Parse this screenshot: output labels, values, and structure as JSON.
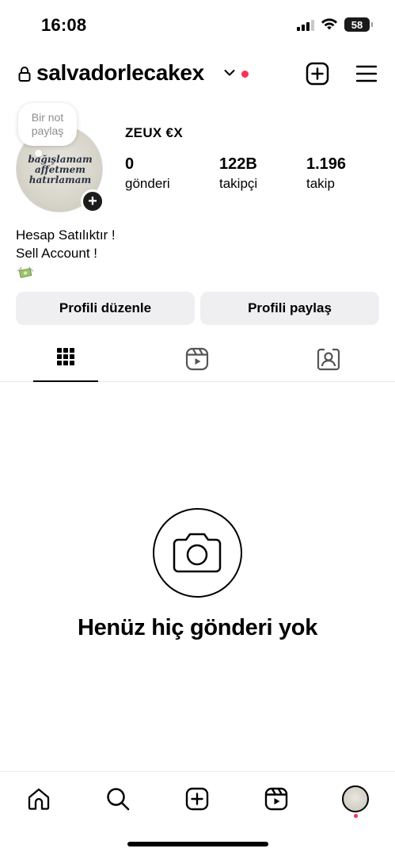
{
  "status_bar": {
    "time": "16:08",
    "battery_level": "58",
    "icons": [
      "signal-icon",
      "wifi-icon",
      "battery-icon"
    ]
  },
  "header": {
    "username": "salvadorlecakex",
    "icons": [
      "lock-icon",
      "chevron-down-icon",
      "add-post-icon",
      "menu-icon"
    ],
    "notification_dot_color": "#ff2d55"
  },
  "note": {
    "line1": "Bir not",
    "line2": "paylaş"
  },
  "avatar": {
    "text_lines": [
      "bağışlamam",
      "affetmem",
      "hatırlamam"
    ]
  },
  "profile": {
    "display_name": "ZEUX €X",
    "stats": [
      {
        "value": "0",
        "label": "gönderi"
      },
      {
        "value": "122B",
        "label": "takipçi"
      },
      {
        "value": "1.196",
        "label": "takip"
      }
    ],
    "bio_lines": [
      "Hesap Satılıktır !",
      "Sell Account !"
    ],
    "bio_emoji": "money-with-wings-icon"
  },
  "buttons": {
    "edit_profile": "Profili düzenle",
    "share_profile": "Profili paylaş"
  },
  "tabs": [
    {
      "name": "grid-icon",
      "active": true
    },
    {
      "name": "reels-icon",
      "active": false
    },
    {
      "name": "tagged-icon",
      "active": false
    }
  ],
  "empty_state": {
    "title": "Henüz hiç gönderi yok",
    "icon": "camera-icon"
  },
  "bottom_nav": {
    "items": [
      "home-icon",
      "search-icon",
      "create-icon",
      "reels-icon",
      "profile-avatar"
    ],
    "active_dot_color": "#ff2d55"
  },
  "colors": {
    "button_bg": "#efeff1",
    "accent_red": "#ff2d55"
  }
}
